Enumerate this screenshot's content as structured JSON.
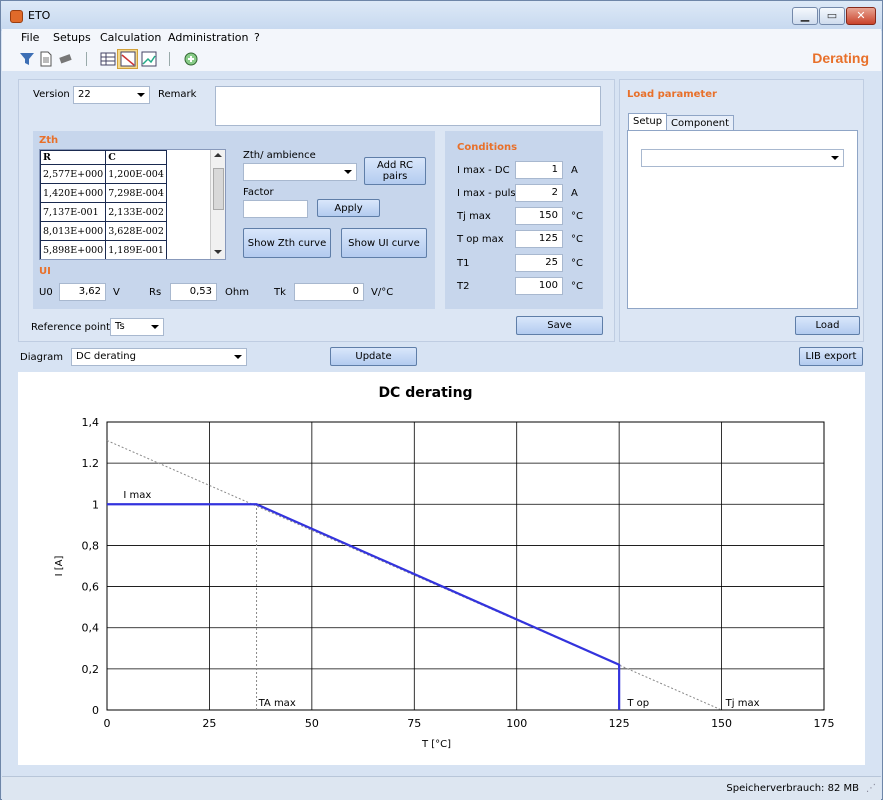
{
  "window": {
    "title": "ETO"
  },
  "menu": [
    "File",
    "Setups",
    "Calculation",
    "Administration",
    "?"
  ],
  "toolbar": {
    "icons": [
      "filter-icon",
      "document-icon",
      "chip-icon",
      "table-icon",
      "chart-selected-icon",
      "chart-icon",
      "refresh-icon"
    ],
    "page_title": "Derating"
  },
  "version": {
    "label": "Version",
    "value": "22",
    "remark_label": "Remark",
    "remark_value": ""
  },
  "zth": {
    "title": "Zth",
    "columns": [
      "R",
      "C"
    ],
    "rows": [
      [
        "2,577E+000",
        "1,200E-004"
      ],
      [
        "1,420E+000",
        "7,298E-004"
      ],
      [
        "7,137E-001",
        "2,133E-002"
      ],
      [
        "8,013E+000",
        "3,628E-002"
      ],
      [
        "5,898E+000",
        "1,189E-001"
      ]
    ],
    "ambience_label": "Zth/ ambience",
    "ambience_value": "",
    "add_rc_label": "Add RC pairs",
    "factor_label": "Factor",
    "factor_value": "",
    "apply_label": "Apply",
    "show_zth_label": "Show Zth curve",
    "show_ui_label": "Show UI curve"
  },
  "ui": {
    "title": "UI",
    "u0_label": "U0",
    "u0_value": "3,62",
    "u0_unit": "V",
    "rs_label": "Rs",
    "rs_value": "0,53",
    "rs_unit": "Ohm",
    "tk_label": "Tk",
    "tk_value": "0",
    "tk_unit": "V/°C"
  },
  "reference": {
    "label": "Reference point",
    "value": "Ts"
  },
  "conditions": {
    "title": "Conditions",
    "rows": [
      {
        "label": "I max - DC",
        "value": "1",
        "unit": "A"
      },
      {
        "label": "I max - pulse",
        "value": "2",
        "unit": "A"
      },
      {
        "label": "Tj max",
        "value": "150",
        "unit": "°C"
      },
      {
        "label": "T op max",
        "value": "125",
        "unit": "°C"
      },
      {
        "label": "T1",
        "value": "25",
        "unit": "°C"
      },
      {
        "label": "T2",
        "value": "100",
        "unit": "°C"
      }
    ],
    "save_label": "Save"
  },
  "load": {
    "title": "Load parameter",
    "tabs": [
      "Setup",
      "Component"
    ],
    "combo_value": "",
    "load_label": "Load"
  },
  "diagram": {
    "label": "Diagram",
    "value": "DC derating",
    "update_label": "Update",
    "lib_export_label": "LIB export"
  },
  "status": {
    "memory": "Speicherverbrauch: 82 MB"
  },
  "chart_data": {
    "type": "line",
    "title": "DC derating",
    "xlabel": "T [°C]",
    "ylabel": "I [A]",
    "xlim": [
      0,
      175
    ],
    "ylim": [
      0,
      1.4
    ],
    "xticks": [
      0,
      25,
      50,
      75,
      100,
      125,
      150,
      175
    ],
    "yticks": [
      0,
      0.2,
      0.4,
      0.6,
      0.8,
      1,
      1.2,
      1.4
    ],
    "ytick_labels": [
      "0",
      "0,2",
      "0,4",
      "0,6",
      "0,8",
      "1",
      "1.2",
      "1,4"
    ],
    "grid": true,
    "series": [
      {
        "x": [
          0,
          36.5,
          125,
          125
        ],
        "y": [
          1,
          1,
          0.22,
          0
        ],
        "color": "#3333dd"
      }
    ],
    "reference_line": {
      "x": [
        0,
        150
      ],
      "y": [
        1.31,
        0
      ],
      "color": "#888888"
    },
    "vline": {
      "x": 36.5,
      "y": [
        0,
        1
      ]
    },
    "annotations": [
      {
        "text": "I max",
        "x": 4,
        "y": 1.03
      },
      {
        "text": "TA max",
        "x": 37,
        "y": 0.02
      },
      {
        "text": "T op",
        "x": 127,
        "y": 0.02
      },
      {
        "text": "Tj max",
        "x": 151,
        "y": 0.02
      }
    ]
  }
}
